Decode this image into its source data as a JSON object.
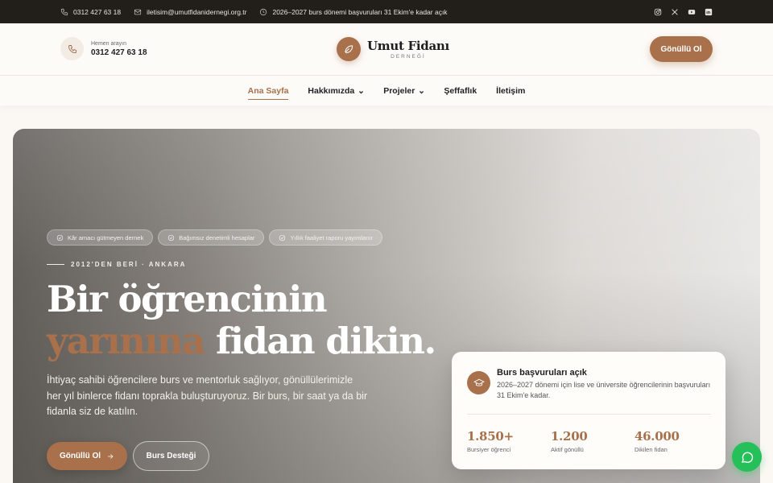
{
  "topbar": {
    "phone": "0312 427 63 18",
    "email": "iletisim@umutfidanidernegi.org.tr",
    "notice": "2026–2027 burs dönemi başvuruları 31 Ekim'e kadar açık",
    "social_icons": [
      "instagram-icon",
      "x-icon",
      "youtube-icon",
      "linkedin-icon"
    ]
  },
  "header": {
    "call_label": "Hemen arayın",
    "call_number": "0312 427 63 18",
    "brand_name": "Umut Fidanı",
    "brand_sub": "DERNEĞİ",
    "volunteer_button": "Gönüllü Ol"
  },
  "nav": {
    "items": [
      {
        "label": "Ana Sayfa",
        "active": true
      },
      {
        "label": "Hakkımızda"
      },
      {
        "label": "Projeler"
      },
      {
        "label": "Şeffaflık"
      },
      {
        "label": "İletişim"
      }
    ]
  },
  "hero": {
    "badges": [
      "Kâr amacı gütmeyen dernek",
      "Bağımsız denetimli hesaplar",
      "Yıllık faaliyet raporu yayımlanır"
    ],
    "eyebrow": "2012'DEN BERİ · ANKARA",
    "title_line1": "Bir öğrencinin",
    "title_accent": "yarınına",
    "title_rest": " fidan dikin.",
    "lead": "İhtiyaç sahibi öğrencilere burs ve mentorluk sağlıyor, gönüllülerimizle her yıl binlerce fidanı toprakla buluşturuyoruz. Bir burs, bir saat ya da bir fidanla siz de katılın.",
    "primary_button": "Gönüllü Ol",
    "secondary_button": "Burs Desteği"
  },
  "card": {
    "title": "Burs başvuruları açık",
    "text": "2026–2027 dönemi için lise ve üniversite öğrencilerinin başvuruları 31 Ekim'e kadar.",
    "stats": [
      {
        "value": "1.850+",
        "label": "Bursiyer öğrenci"
      },
      {
        "value": "1.200",
        "label": "Aktif gönüllü"
      },
      {
        "value": "46.000",
        "label": "Dikilen fidan"
      }
    ]
  },
  "colors": {
    "accent": "#a8704b",
    "topbar_bg": "#221e1a",
    "chat": "#25c05a"
  }
}
